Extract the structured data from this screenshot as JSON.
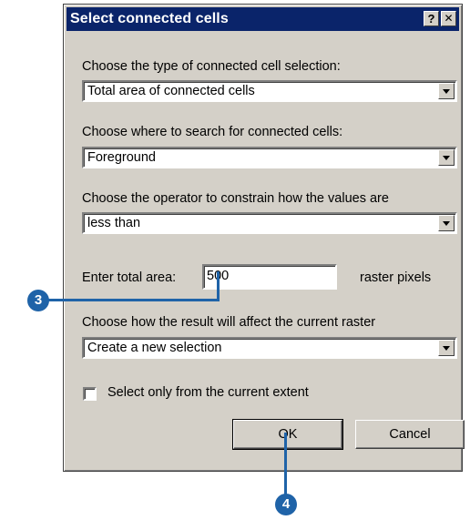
{
  "dialog": {
    "title": "Select connected cells",
    "help_button": "?",
    "close_button": "✕"
  },
  "fields": {
    "selection_type_label": "Choose the type of connected cell selection:",
    "selection_type_value": "Total area of connected cells",
    "search_label": "Choose where to search for connected cells:",
    "search_value": "Foreground",
    "operator_label": "Choose the operator to constrain how the values are",
    "operator_value": "less than",
    "area_label": "Enter total area:",
    "area_value": "500",
    "area_unit": "raster pixels",
    "result_label": "Choose how the result will affect the current raster",
    "result_value": "Create a new selection",
    "extent_checkbox_label": "Select only from the current extent",
    "extent_checked": false
  },
  "buttons": {
    "ok": "OK",
    "cancel": "Cancel"
  },
  "callouts": {
    "area_step": "3",
    "ok_step": "4",
    "color": "#1f63a8"
  }
}
